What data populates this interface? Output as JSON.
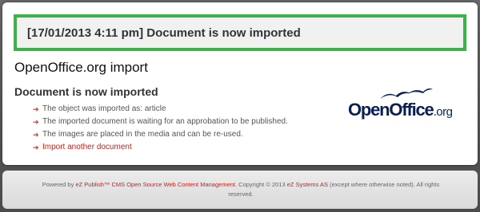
{
  "message": {
    "text": "[17/01/2013 4:11 pm] Document is now imported"
  },
  "page": {
    "title": "OpenOffice.org import",
    "section_heading": "Document is now imported"
  },
  "results": [
    {
      "text": "The object was imported as: article",
      "link": false
    },
    {
      "text": "The imported document is waiting for an approbation to be published.",
      "link": false
    },
    {
      "text": "The images are placed in the media and can be re-used.",
      "link": false
    },
    {
      "text": "Import another document",
      "link": true
    }
  ],
  "logo": {
    "name": "OpenOffice",
    "suffix": ".org",
    "icon": "openoffice-birds-icon"
  },
  "footer": {
    "prefix": "Powered by ",
    "product_link": "eZ Publish™ CMS Open Source Web Content Management",
    "copyright": ". Copyright © 2013 ",
    "company_link": "eZ Systems AS",
    "suffix": " (except where otherwise noted). All rights reserved."
  },
  "colors": {
    "accent_green": "#3cb346",
    "link_red": "#c8221c",
    "logo_navy": "#0a1f52"
  }
}
